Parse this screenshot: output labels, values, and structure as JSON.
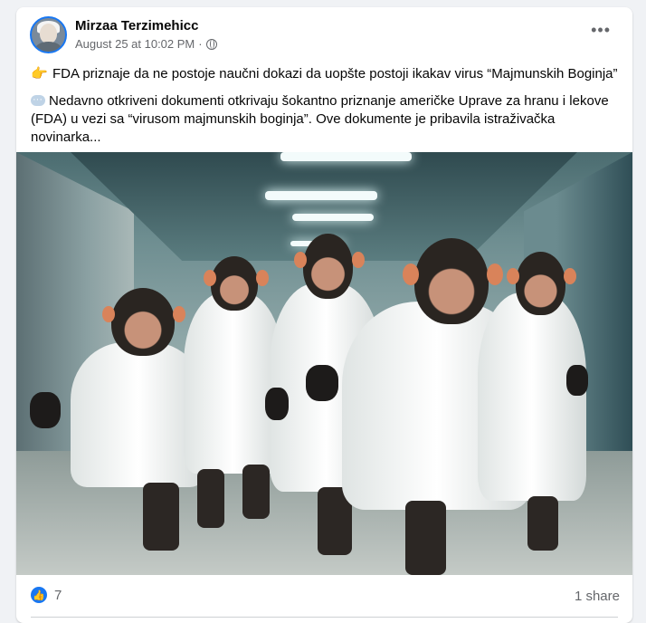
{
  "post": {
    "author": "Mirzaa Terzimehicc",
    "timestamp": "August 25 at 10:02 PM",
    "separator": "·",
    "visibility_icon": "globe-icon",
    "more_icon": "more-options-icon",
    "line1_emoji": "👉",
    "line1_text": "FDA priznaje da ne postoje naučni dokazi da uopšte postoji ikakav virus “Majmunskih Boginja”",
    "para2_icon": "speech-bubble-icon",
    "para2_text": "Nedavno otkriveni dokumenti otkrivaju šokantno priznanje američke Uprave za hranu i lekove (FDA) u vezi sa “virusom majmunskih boginja”. Ove dokumente je pribavila istraživačka novinarka..."
  },
  "footer": {
    "like_count": "7",
    "share_count": "1 share"
  },
  "colors": {
    "brand_blue": "#1877f2",
    "text_secondary": "#65676b"
  }
}
